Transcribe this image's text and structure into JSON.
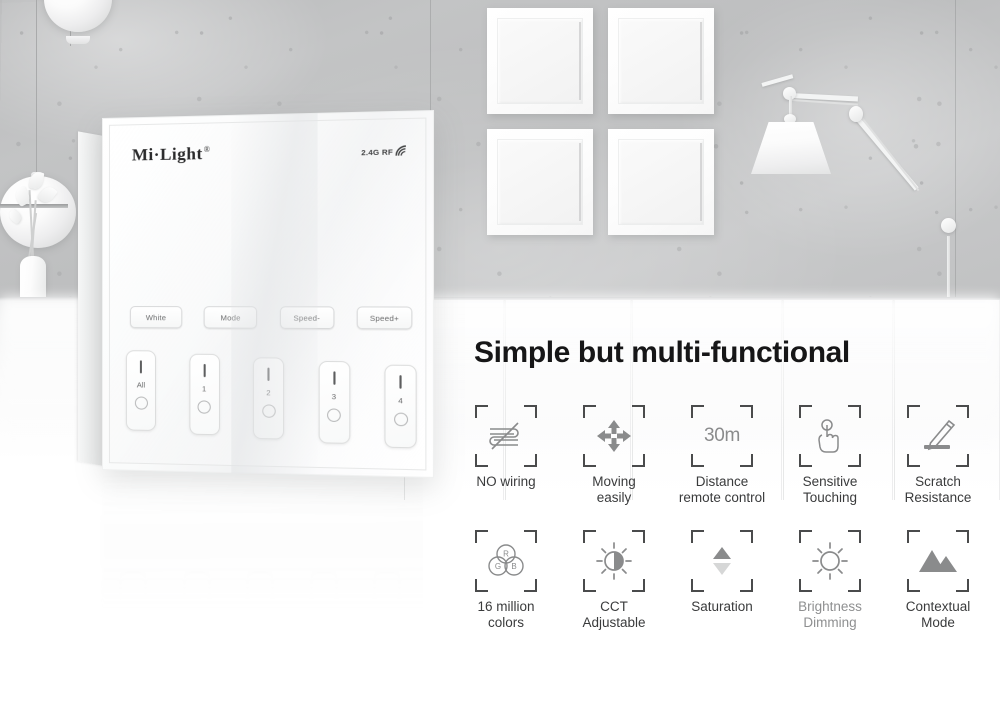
{
  "headline": "Simple but multi-functional",
  "product": {
    "brand": "Mi·Light",
    "brand_mark": "®",
    "rf_badge": "2.4G RF",
    "rf_icon": "signal-waves-icon",
    "function_buttons": [
      {
        "label": "White",
        "name": "white-button"
      },
      {
        "label": "Mode",
        "name": "mode-button"
      },
      {
        "label": "Speed-",
        "name": "speed-down-button"
      },
      {
        "label": "Speed+",
        "name": "speed-up-button"
      }
    ],
    "zone_buttons": [
      {
        "label": "All",
        "name": "zone-all-button"
      },
      {
        "label": "1",
        "name": "zone-1-button"
      },
      {
        "label": "2",
        "name": "zone-2-button"
      },
      {
        "label": "3",
        "name": "zone-3-button"
      },
      {
        "label": "4",
        "name": "zone-4-button"
      }
    ],
    "strips": {
      "rgb": {
        "name": "rgb-color-strip",
        "colors": [
          "#e8102a",
          "#e00f33",
          "#d81047",
          "#d21260",
          "#cc1478",
          "#c4178f",
          "#b31aa0",
          "#9c1cab",
          "#8520b4",
          "#6f24bc",
          "#5a28c2",
          "#4630c6",
          "#3538c8",
          "#2a46c6",
          "#2156c4",
          "#1a66c2",
          "#1676c0",
          "#1486bd",
          "#1295b8",
          "#14a3ae",
          "#1aae9e",
          "#22b58a",
          "#2dba74",
          "#3dbe5e",
          "#52c14c",
          "#6bc442",
          "#86c73c",
          "#a0ca38",
          "#b8cd35",
          "#cdd032",
          "#ddd02f",
          "#e8c82c",
          "#f0bc2a",
          "#f4ac27",
          "#f59a25",
          "#f48723",
          "#f27321",
          "#ef5f20",
          "#eb4b1f",
          "#e6371f",
          "#e2231f"
        ]
      },
      "cct": {
        "name": "cct-color-strip",
        "top": [
          "#f6c51f",
          "#f7cb2c",
          "#f8d13c",
          "#f9d850",
          "#fadf68",
          "#fbe684",
          "#fcecA0",
          "#fdf2bc",
          "#fef7d6",
          "#fffbe9",
          "#fffef8",
          "#f4fbfd",
          "#e4f5fb",
          "#d0eef8",
          "#b9e6f5",
          "#9fdcf2",
          "#82d2ef",
          "#62c7ec",
          "#3fbce9",
          "#1fb2e6"
        ],
        "bottom": [
          "#e01e22",
          "#e22522",
          "#e42d23",
          "#e63624",
          "#e84026",
          "#ea4c29",
          "#ec5a2e",
          "#ee6a36",
          "#f07c42",
          "#f28e52",
          "#f09a66",
          "#ee9f74",
          "#eca286",
          "#eaa596",
          "#e8a8a4",
          "#e6abb0",
          "#e4aeba",
          "#e2b1c2",
          "#e0b4c8",
          "#deb7cc"
        ]
      },
      "brightness": {
        "name": "brightness-strip",
        "colors": [
          "#0d0d0e",
          "#141415",
          "#1b1b1c",
          "#232324",
          "#2b2b2c",
          "#343435",
          "#3d3d3e",
          "#474748",
          "#515152",
          "#5c5c5d",
          "#676768",
          "#737374",
          "#7f7f80",
          "#8b8b8c",
          "#979798",
          "#a3a3a4",
          "#afafb0",
          "#bbbbbc",
          "#c7c7c8",
          "#d3d3d4",
          "#dfdfe0",
          "#e9e9ea",
          "#f1f1f2"
        ]
      }
    }
  },
  "features": [
    {
      "label": "NO wiring",
      "icon": "no-wiring-icon",
      "muted": false
    },
    {
      "label": "Moving\neasily",
      "icon": "move-arrows-icon",
      "muted": false
    },
    {
      "label": "Distance\nremote control",
      "icon": "distance-30m-icon",
      "muted": false,
      "value": "30m"
    },
    {
      "label": "Sensitive\nTouching",
      "icon": "touch-hand-icon",
      "muted": false
    },
    {
      "label": "Scratch\nResistance",
      "icon": "pen-scratch-icon",
      "muted": false
    },
    {
      "label": "16 million\ncolors",
      "icon": "rgb-venn-icon",
      "muted": false
    },
    {
      "label": "CCT\nAdjustable",
      "icon": "cct-sun-icon",
      "muted": false
    },
    {
      "label": "Saturation",
      "icon": "saturation-arrows-icon",
      "muted": false
    },
    {
      "label": "Brightness\nDimming",
      "icon": "brightness-sun-icon",
      "muted": true
    },
    {
      "label": "Contextual\nMode",
      "icon": "mountains-icon",
      "muted": false
    }
  ],
  "scene": {
    "pendant_lamps": [
      "pendant-globe-lamp-1",
      "pendant-globe-lamp-2"
    ],
    "wall_frames": [
      "wall-frame-1",
      "wall-frame-2",
      "wall-frame-3",
      "wall-frame-4"
    ],
    "desk_lamp": "articulated-desk-lamp",
    "vase": "vase-with-lilies"
  },
  "colors": {
    "headline": "#161617",
    "icon_outline": "#4a4b4c",
    "icon_fill": "#8a8b8c",
    "label": "#3a3b3c",
    "label_muted": "#8e8f90",
    "wall": "#c1c2c3"
  }
}
